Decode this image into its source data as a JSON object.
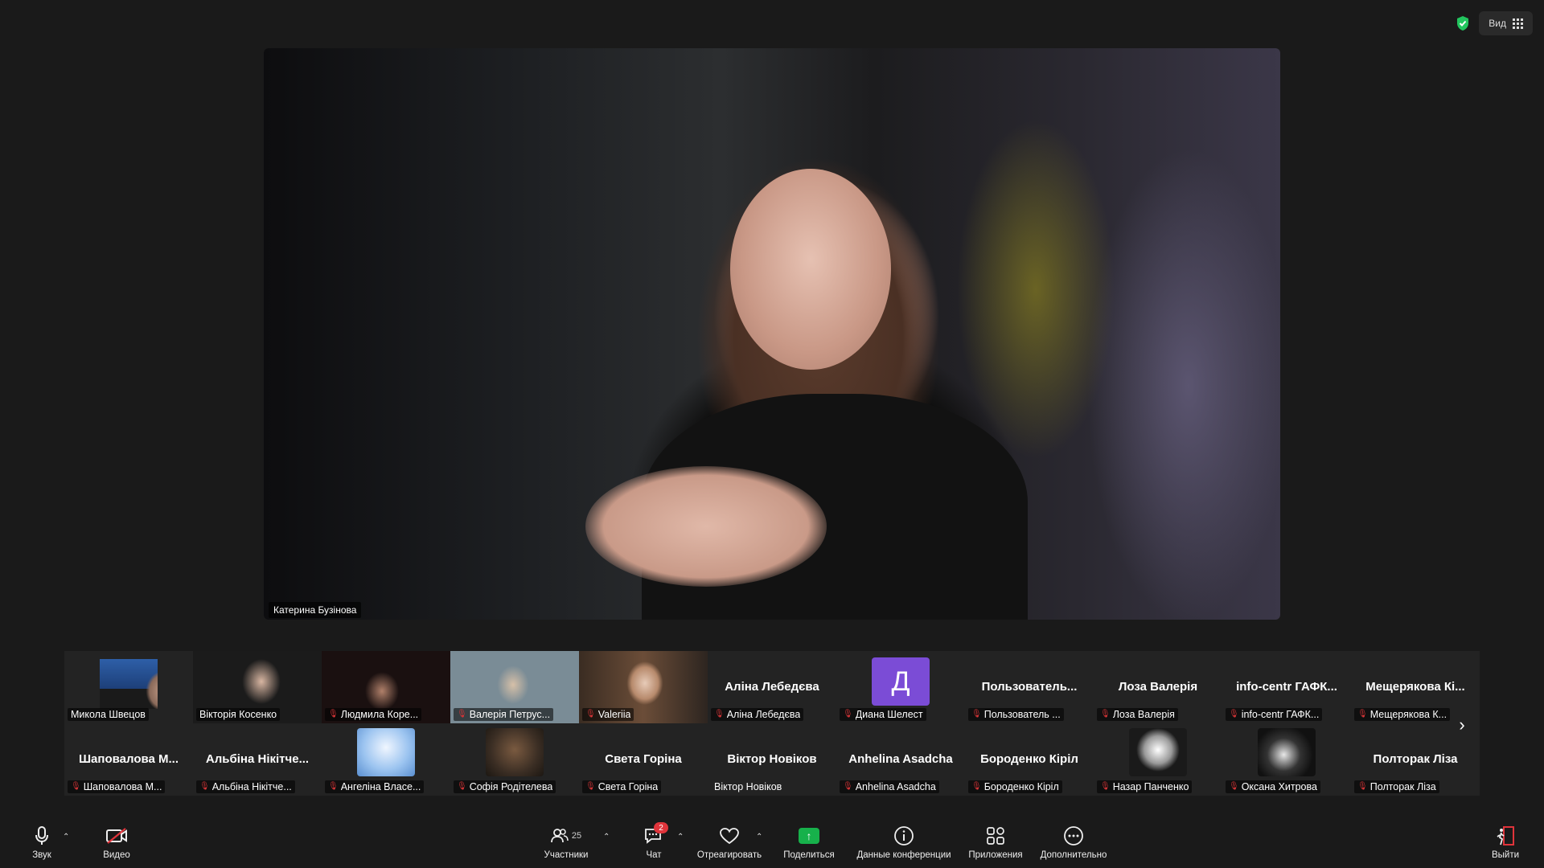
{
  "top": {
    "view_label": "Вид",
    "shield_color": "#22c55e"
  },
  "main_video": {
    "speaker_name": "Катерина Бузінова"
  },
  "gallery": {
    "row1": [
      {
        "name": "Микола Швецов",
        "muted": false,
        "display": "video"
      },
      {
        "name": "Вікторія Косенко",
        "muted": false,
        "display": "video"
      },
      {
        "name": "Людмила Коре...",
        "muted": true,
        "display": "video"
      },
      {
        "name": "Валерія Петрус...",
        "muted": true,
        "display": "video"
      },
      {
        "name": "Valeriia",
        "muted": true,
        "display": "video"
      },
      {
        "name": "Аліна Лебедєва",
        "big_name": "Аліна Лебедєва",
        "muted": true,
        "display": "name"
      },
      {
        "name": "Диана Шелест",
        "letter": "Д",
        "muted": true,
        "display": "letter"
      },
      {
        "name": "Пользователь ...",
        "big_name": "Пользователь...",
        "muted": true,
        "display": "name"
      },
      {
        "name": "Лоза Валерія",
        "big_name": "Лоза Валерія",
        "muted": true,
        "display": "name"
      },
      {
        "name": "info-centr ГАФК...",
        "big_name": "info-centr ГАФК...",
        "muted": true,
        "display": "name"
      },
      {
        "name": "Мещерякова К...",
        "big_name": "Мещерякова Кі...",
        "muted": true,
        "display": "name"
      }
    ],
    "row2": [
      {
        "name": "Шаповалова М...",
        "big_name": "Шаповалова М...",
        "muted": true,
        "display": "name"
      },
      {
        "name": "Альбіна Нікітче...",
        "big_name": "Альбіна Нікітче...",
        "muted": true,
        "display": "name"
      },
      {
        "name": "Ангеліна Власе...",
        "muted": true,
        "display": "avatar"
      },
      {
        "name": "Софія Родітелева",
        "muted": true,
        "display": "avatar"
      },
      {
        "name": "Света Горіна",
        "big_name": "Света Горіна",
        "muted": true,
        "display": "name"
      },
      {
        "name": "Віктор Новіков",
        "big_name": "Віктор Новіков",
        "muted": false,
        "display": "name"
      },
      {
        "name": "Anhelina Asadcha",
        "big_name": "Anhelina Asadcha",
        "muted": true,
        "display": "name"
      },
      {
        "name": "Бороденко Кірiл",
        "big_name": "Бороденко Кірiл",
        "muted": true,
        "display": "name"
      },
      {
        "name": "Назар Панченко",
        "muted": true,
        "display": "avatar"
      },
      {
        "name": "Оксана Хитрова",
        "muted": true,
        "display": "avatar"
      },
      {
        "name": "Полторак Ліза",
        "big_name": "Полторак Ліза",
        "muted": true,
        "display": "name"
      }
    ]
  },
  "toolbar": {
    "audio": "Звук",
    "video": "Видео",
    "participants": "Участники",
    "participants_count": "25",
    "chat": "Чат",
    "chat_badge": "2",
    "react": "Отреагировать",
    "share": "Поделиться",
    "info": "Данные конференции",
    "apps": "Приложения",
    "more": "Дополнительно",
    "leave": "Выйти"
  },
  "colors": {
    "mute_red": "#e0343b",
    "share_green": "#17b14b",
    "avatar_purple": "#7b4cd6"
  }
}
